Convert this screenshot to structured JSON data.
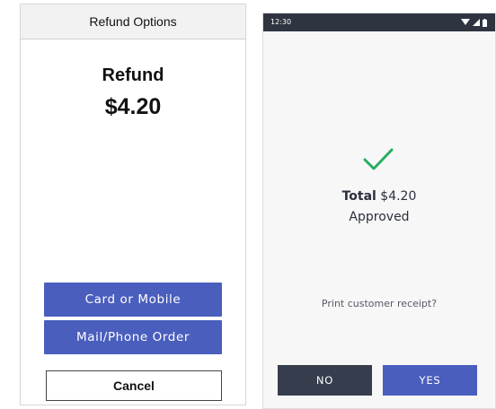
{
  "left_screen": {
    "header_title": "Refund Options",
    "refund_label": "Refund",
    "refund_amount": "$4.20",
    "buttons": {
      "card_or_mobile": "Card or Mobile",
      "mail_phone_order": "Mail/Phone Order",
      "cancel": "Cancel"
    }
  },
  "right_screen": {
    "status_bar": {
      "time": "12:30",
      "icons": [
        "wifi-icon",
        "signal-icon",
        "battery-icon"
      ]
    },
    "status_icon": "checkmark-icon",
    "total_label": "Total",
    "total_amount": "$4.20",
    "status_text": "Approved",
    "receipt_prompt": "Print customer receipt?",
    "buttons": {
      "no": "NO",
      "yes": "YES"
    }
  },
  "colors": {
    "primary_blue": "#4a5ebd",
    "dark_navy": "#363d4c",
    "status_bar": "#2e3440",
    "success_green": "#27ae60"
  }
}
